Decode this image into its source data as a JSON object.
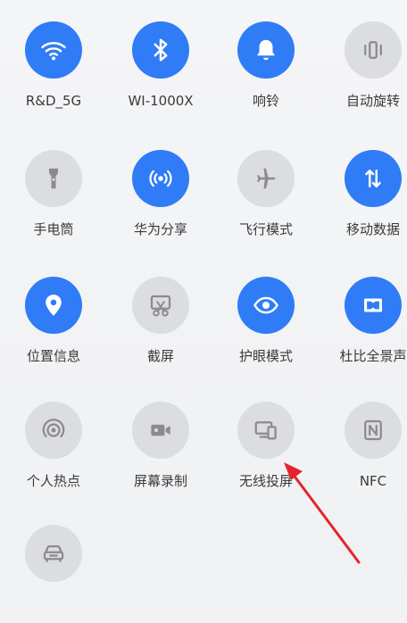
{
  "quick_settings": {
    "tiles": [
      {
        "label": "R&D_5G",
        "icon": "wifi-icon",
        "state": "on"
      },
      {
        "label": "WI-1000X",
        "icon": "bluetooth-icon",
        "state": "on"
      },
      {
        "label": "响铃",
        "icon": "bell-icon",
        "state": "on"
      },
      {
        "label": "自动旋转",
        "icon": "auto-rotate-icon",
        "state": "off"
      },
      {
        "label": "手电筒",
        "icon": "flashlight-icon",
        "state": "off"
      },
      {
        "label": "华为分享",
        "icon": "huawei-share-icon",
        "state": "on"
      },
      {
        "label": "飞行模式",
        "icon": "airplane-icon",
        "state": "off"
      },
      {
        "label": "移动数据",
        "icon": "mobile-data-icon",
        "state": "on"
      },
      {
        "label": "位置信息",
        "icon": "location-icon",
        "state": "on"
      },
      {
        "label": "截屏",
        "icon": "screenshot-icon",
        "state": "off"
      },
      {
        "label": "护眼模式",
        "icon": "eye-comfort-icon",
        "state": "on"
      },
      {
        "label": "杜比全景声",
        "icon": "dolby-icon",
        "state": "on"
      },
      {
        "label": "个人热点",
        "icon": "hotspot-icon",
        "state": "off"
      },
      {
        "label": "屏幕录制",
        "icon": "screen-record-icon",
        "state": "off"
      },
      {
        "label": "无线投屏",
        "icon": "wireless-projection-icon",
        "state": "off"
      },
      {
        "label": "NFC",
        "icon": "nfc-icon",
        "state": "off"
      },
      {
        "label": "",
        "icon": "car-icon",
        "state": "off"
      }
    ]
  },
  "colors": {
    "accent": "#2f7cf6",
    "tile_off": "#dcdde0",
    "icon_on": "#ffffff",
    "icon_off": "#8b8b8f",
    "arrow": "#e3242b"
  }
}
